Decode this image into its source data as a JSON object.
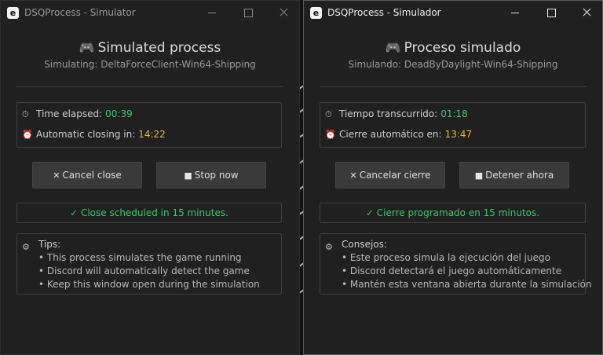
{
  "windows": [
    {
      "title": "DSQProcess - Simulator",
      "app_icon": "e",
      "heading": "Simulated process",
      "subheading": "Simulating: DeltaForceClient-Win64-Shipping",
      "elapsed_label": "Time elapsed:",
      "elapsed_value": "00:39",
      "closing_label": "Automatic closing in:",
      "closing_value": "14:22",
      "cancel_label": "Cancel close",
      "stop_label": "Stop now",
      "status": "Close scheduled in 15 minutes.",
      "tips_label": "Tips:",
      "tips": [
        "• This process simulates the game running",
        "• Discord will automatically detect the game",
        "• Keep this window open during the simulation"
      ]
    },
    {
      "title": "DSQProcess - Simulador",
      "app_icon": "e",
      "heading": "Proceso simulado",
      "subheading": "Simulando: DeadByDaylight-Win64-Shipping",
      "elapsed_label": "Tiempo transcurrido:",
      "elapsed_value": "01:18",
      "closing_label": "Cierre automático en:",
      "closing_value": "13:47",
      "cancel_label": "Cancelar cierre",
      "stop_label": "Detener ahora",
      "status": "Cierre programado en 15 minutos.",
      "tips_label": "Consejos:",
      "tips": [
        "• Este proceso simula la ejecución del juego",
        "• Discord detectará el juego automáticamente",
        "• Mantén esta ventana abierta durante la simulación"
      ]
    }
  ],
  "icons": {
    "gamepad": "🎮",
    "stopwatch": "⏱",
    "alarm": "⏰",
    "cancel": "✕",
    "stop": "■",
    "check": "✓",
    "tips": "⚙"
  },
  "colors": {
    "background": "#202020",
    "success": "#3ec46d",
    "warning": "#f0b429",
    "button": "#3a3a3a",
    "border": "#3f3f3f"
  }
}
